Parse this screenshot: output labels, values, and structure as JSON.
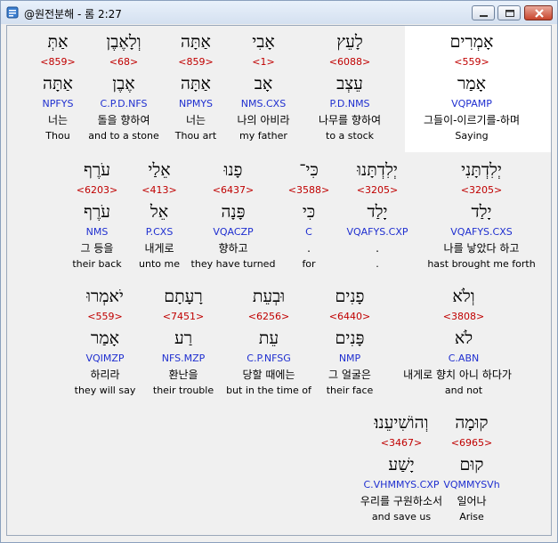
{
  "window": {
    "title": "@원전분해 - 롬 2:27"
  },
  "rows": [
    {
      "words": [
        {
          "heb": "אָמְרִים",
          "strong": "<559>",
          "lex": "אָמַר",
          "morph": "VQPAMP",
          "ko": "그들이-이르기를-하며",
          "en": "Saying",
          "selected": true
        },
        {
          "heb": "לָעֵץ",
          "strong": "<6088>",
          "lex": "עֵצְב",
          "morph": "P.D.NMS",
          "ko": "나무를 향하여",
          "en": "to a stock"
        },
        {
          "heb": "אָבִי",
          "strong": "<1>",
          "lex": "אָב",
          "morph": "NMS.CXS",
          "ko": "나의 아비라",
          "en": "my father"
        },
        {
          "heb": "אַתָּה",
          "strong": "<859>",
          "lex": "אַתָּה",
          "morph": "NPMYS",
          "ko": "너는",
          "en": "Thou art"
        },
        {
          "heb": "וְלָאֶבֶן",
          "strong": "<68>",
          "lex": "אֶבֶן",
          "morph": "C.P.D.NFS",
          "ko": "돌을 향하여",
          "en": "and to a stone"
        },
        {
          "heb": "אַתְּ",
          "strong": "<859>",
          "lex": "אַתָּה",
          "morph": "NPFYS",
          "ko": "너는",
          "en": "Thou"
        }
      ]
    },
    {
      "words": [
        {
          "heb": "יְלִדְתָּנִי",
          "strong": "<3205>",
          "lex": "יָלַד",
          "morph": "VQAFYS.CXS",
          "ko": "나를 낳았다 하고",
          "en": "hast brought me forth"
        },
        {
          "heb": "יְלִדְתָּנוּ",
          "strong": "<3205>",
          "lex": "יָלַד",
          "morph": "VQAFYS.CXP",
          "ko": ".",
          "en": "."
        },
        {
          "heb": "כִּי־",
          "strong": "<3588>",
          "lex": "כִּי",
          "morph": "C",
          "ko": ".",
          "en": "for"
        },
        {
          "heb": "פָנוּ",
          "strong": "<6437>",
          "lex": "פָּנָה",
          "morph": "VQACZP",
          "ko": "향하고",
          "en": "they have turned"
        },
        {
          "heb": "אֵלַי",
          "strong": "<413>",
          "lex": "אֵל",
          "morph": "P.CXS",
          "ko": "내게로",
          "en": "unto me"
        },
        {
          "heb": "עֹרֶף",
          "strong": "<6203>",
          "lex": "עֹרֶף",
          "morph": "NMS",
          "ko": "그 등을",
          "en": "their back"
        }
      ]
    },
    {
      "words": [
        {
          "heb": "וְלֹא",
          "strong": "<3808>",
          "lex": "לֹא",
          "morph": "C.ABN",
          "ko": "내게로 향치 아니 하다가",
          "en": "and not"
        },
        {
          "heb": "פָנִים",
          "strong": "<6440>",
          "lex": "פָּנִים",
          "morph": "NMP",
          "ko": "그 얼굴은",
          "en": "their face"
        },
        {
          "heb": "וּבְעֵת",
          "strong": "<6256>",
          "lex": "עֵת",
          "morph": "C.P.NFSG",
          "ko": "당할 때에는",
          "en": "but in the time of"
        },
        {
          "heb": "רָעָתָם",
          "strong": "<7451>",
          "lex": "רַע",
          "morph": "NFS.MZP",
          "ko": "환난을",
          "en": "their trouble"
        },
        {
          "heb": "יֹאמְרוּ",
          "strong": "<559>",
          "lex": "אָמַר",
          "morph": "VQIMZP",
          "ko": "하리라",
          "en": "they will say"
        }
      ]
    },
    {
      "words": [
        {
          "heb": "קוּמָה",
          "strong": "<6965>",
          "lex": "קוּם",
          "morph": "VQMMYSVh",
          "ko": "일어나",
          "en": "Arise"
        },
        {
          "heb": "וְהוֹשִׁיעֵנוּ׃",
          "strong": "<3467>",
          "lex": "יָשַׁע",
          "morph": "C.VHMMYS.CXP",
          "ko": "우리를 구원하소서",
          "en": "and save us"
        }
      ]
    }
  ]
}
